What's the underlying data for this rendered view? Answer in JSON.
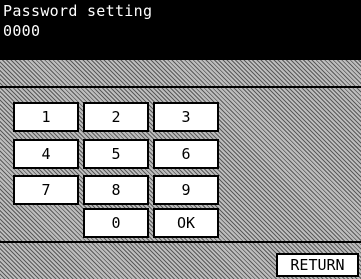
{
  "header": {
    "title": "Password setting",
    "entry": "0000"
  },
  "keypad": {
    "k1": "1",
    "k2": "2",
    "k3": "3",
    "k4": "4",
    "k5": "5",
    "k6": "6",
    "k7": "7",
    "k8": "8",
    "k9": "9",
    "k0": "0",
    "ok": "OK"
  },
  "footer": {
    "return_label": "RETURN"
  }
}
